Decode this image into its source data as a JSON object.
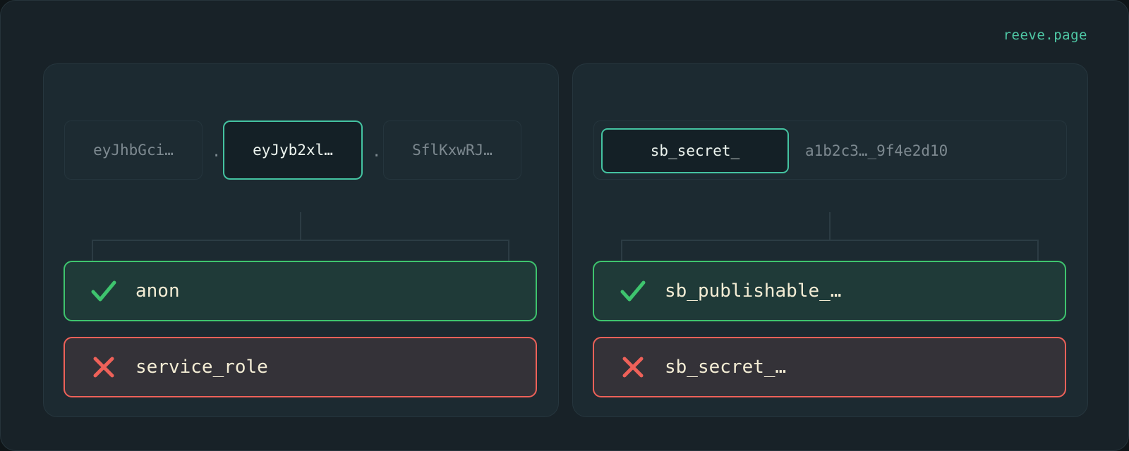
{
  "brand": "reeve.page",
  "left": {
    "segments": [
      {
        "text": "eyJhbGci…",
        "active": false
      },
      {
        "text": "eyJyb2xl…",
        "active": true
      },
      {
        "text": "SflKxwRJ…",
        "active": false
      }
    ],
    "separator": ".",
    "options": [
      {
        "label": "anon",
        "status": "allowed",
        "icon": "check-icon"
      },
      {
        "label": "service_role",
        "status": "denied",
        "icon": "x-icon"
      }
    ]
  },
  "right": {
    "key_prefix": "sb_secret_",
    "key_rest": "a1b2c3…_9f4e2d10",
    "options": [
      {
        "label": "sb_publishable_…",
        "status": "allowed",
        "icon": "check-icon"
      },
      {
        "label": "sb_secret_…",
        "status": "denied",
        "icon": "x-icon"
      }
    ]
  },
  "colors": {
    "accent": "#44c3a1",
    "allowed": "#3ec46e",
    "denied": "#ee6159",
    "text": "#f3ecd4"
  }
}
